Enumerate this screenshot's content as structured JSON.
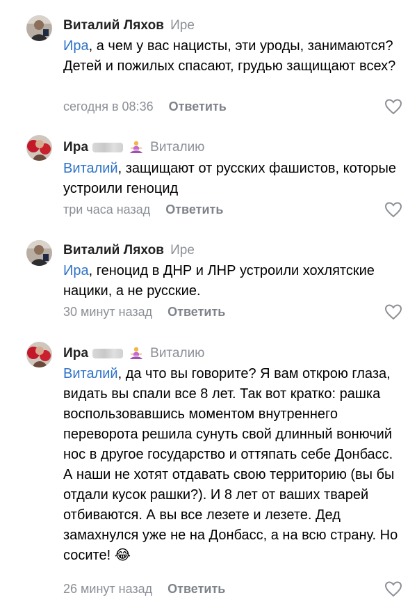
{
  "comments": [
    {
      "author": "Виталий Ляхов",
      "reply_to": "Ире",
      "mention": "Ира",
      "text": ", а чем у вас нацисты, эти уроды, занимаются? Детей и пожилых спасают, грудью защищают всех?",
      "time": "сегодня в 08:36",
      "reply_label": "Ответить",
      "avatar_icon": "user-photo-avatar"
    },
    {
      "author": "Ира",
      "reply_to": "Виталию",
      "mention": "Виталий",
      "text": ", защищают от русских фашистов, которые устроили геноцид",
      "time": "три часа назад",
      "reply_label": "Ответить",
      "badge_icon": "meditation-emoji",
      "avatar_icon": "user-photo-avatar"
    },
    {
      "author": "Виталий Ляхов",
      "reply_to": "Ире",
      "mention": "Ира",
      "text": ", геноцид в ДНР и ЛНР устроили хохлятские нацики, а не русские.",
      "time": "30 минут назад",
      "reply_label": "Ответить",
      "avatar_icon": "user-photo-avatar"
    },
    {
      "author": "Ира",
      "reply_to": "Виталию",
      "mention": "Виталий",
      "text": ", да что вы говорите? Я вам открою глаза, видать вы спали все 8 лет. Так вот кратко: рашка воспользовавшись моментом внутреннего переворота решила сунуть свой длинный вонючий нос в другое государство и оттяпать себе Донбасс. А наши не хотят отдавать свою территорию (вы бы отдали кусок рашки?). И 8 лет от ваших тварей отбиваются. А вы все лезете и лезете. Дед замахнулся уже не на Донбасс, а на всю страну. Но сосите!",
      "trailing_emoji": "😂",
      "time": "26 минут назад",
      "reply_label": "Ответить",
      "badge_icon": "meditation-emoji",
      "avatar_icon": "user-photo-avatar"
    }
  ],
  "colors": {
    "mention": "#2e73c8",
    "muted": "#8b8f96",
    "author": "#222222"
  }
}
